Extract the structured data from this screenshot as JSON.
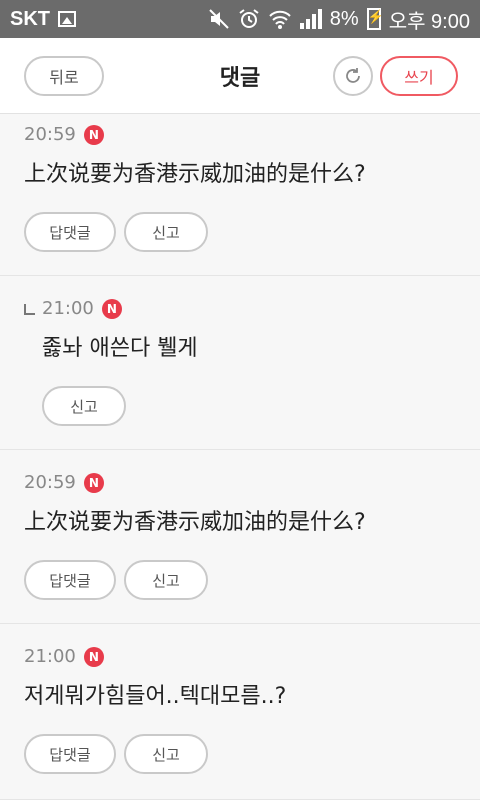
{
  "status_bar": {
    "carrier": "SKT",
    "battery": "8%",
    "time": "오후 9:00",
    "icons": [
      "gallery-icon",
      "mute-icon",
      "alarm-icon",
      "wifi-icon",
      "signal-icon",
      "battery-charging-icon"
    ]
  },
  "header": {
    "back_label": "뒤로",
    "title": "댓글",
    "refresh_icon": "refresh-icon",
    "write_label": "쓰기"
  },
  "comments": [
    {
      "time": "20:59",
      "badge": "N",
      "text": "上次说要为香港示威加油的是什么?",
      "reply_label": "답댓글",
      "report_label": "신고"
    },
    {
      "time": "21:00",
      "badge": "N",
      "text": "졿놔 애쓴다 뷀게",
      "report_label": "신고",
      "is_reply": true
    },
    {
      "time": "20:59",
      "badge": "N",
      "text": "上次说要为香港示威加油的是什么?",
      "reply_label": "답댓글",
      "report_label": "신고"
    },
    {
      "time": "21:00",
      "badge": "N",
      "text": "저게뭐가힘들어..텍대모름..?",
      "reply_label": "답댓글",
      "report_label": "신고"
    }
  ],
  "colors": {
    "status_bar_bg": "#6b6b6b",
    "accent": "#e8454f",
    "badge": "#e83b4b"
  }
}
